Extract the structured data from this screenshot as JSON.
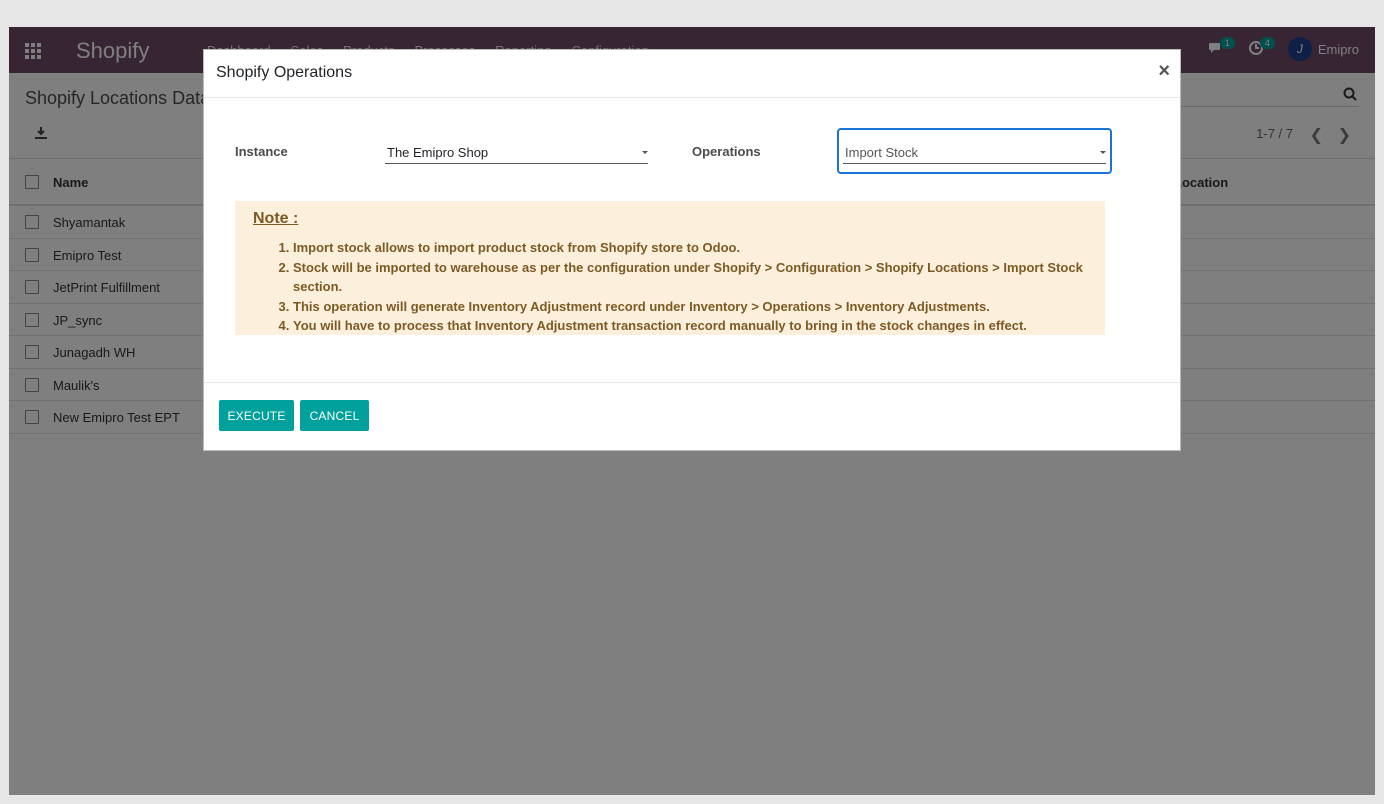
{
  "navbar": {
    "brand": "Shopify",
    "menu": [
      "Dashboard",
      "Sales",
      "Products",
      "Processes",
      "Reporting",
      "Configuration"
    ],
    "messages_count": "1",
    "activities_count": "4",
    "user_name": "Emipro"
  },
  "control": {
    "breadcrumb": "Shopify Locations Data",
    "pager": "1-7 / 7"
  },
  "list": {
    "col_name": "Name",
    "col_location": "Location",
    "rows": [
      "Shyamantak",
      "Emipro Test",
      "JetPrint Fulfillment",
      "JP_sync",
      "Junagadh WH",
      "Maulik's",
      "New Emipro Test EPT"
    ]
  },
  "modal": {
    "title": "Shopify Operations",
    "close_symbol": "×",
    "instance_label": "Instance",
    "instance_value": "The Emipro Shop",
    "operations_label": "Operations",
    "operations_value": "Import Stock",
    "note_title": "Note :",
    "note_items": [
      "Import stock allows to import product stock from Shopify store to Odoo.",
      "Stock will be imported to warehouse as per the configuration under Shopify > Configuration > Shopify Locations > Import Stock section.",
      "This operation will generate Inventory Adjustment record under Inventory > Operations > Inventory Adjustments.",
      "You will have to process that Inventory Adjustment transaction record manually to bring in the stock changes in effect."
    ],
    "execute_label": "EXECUTE",
    "cancel_label": "CANCEL"
  },
  "colors": {
    "navbar": "#714b67",
    "primary_button": "#00a09d",
    "note_background": "#fcefdc",
    "note_text": "#7c5a24",
    "focus_border": "#1a73d9"
  }
}
